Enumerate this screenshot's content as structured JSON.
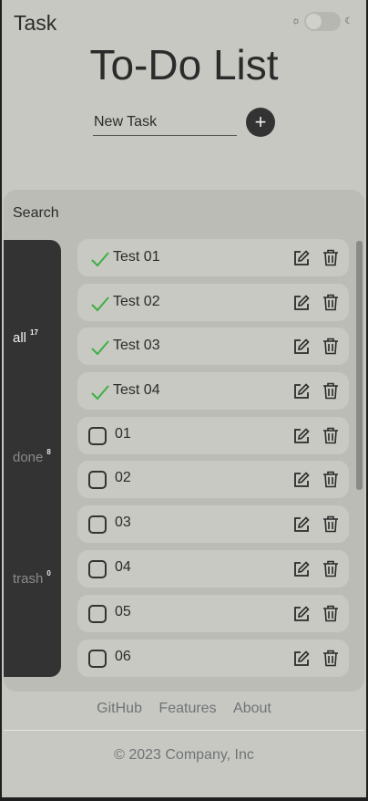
{
  "header": {
    "brand": "Task",
    "theme_toggle": {
      "light_icon": "sun-icon",
      "dark_icon": "moon-icon",
      "state": "light"
    },
    "title": "To-Do List"
  },
  "new_task": {
    "placeholder": "New Task",
    "add_icon": "plus-icon"
  },
  "search": {
    "placeholder": "Search"
  },
  "filters": [
    {
      "label": "all",
      "count": "17",
      "active": true
    },
    {
      "label": "done",
      "count": "8",
      "active": false
    },
    {
      "label": "trash",
      "count": "0",
      "active": false
    }
  ],
  "tasks": [
    {
      "text": "Test 01",
      "done": true
    },
    {
      "text": "Test 02",
      "done": true
    },
    {
      "text": "Test 03",
      "done": true
    },
    {
      "text": "Test 04",
      "done": true
    },
    {
      "text": "01",
      "done": false
    },
    {
      "text": "02",
      "done": false
    },
    {
      "text": "03",
      "done": false
    },
    {
      "text": "04",
      "done": false
    },
    {
      "text": "05",
      "done": false
    },
    {
      "text": "06",
      "done": false
    }
  ],
  "footer": {
    "links": [
      "GitHub",
      "Features",
      "About"
    ],
    "copyright": "© 2023 Company, Inc"
  },
  "colors": {
    "check": "#3cb043",
    "dark": "#333333",
    "background": "#c8c8c2"
  }
}
